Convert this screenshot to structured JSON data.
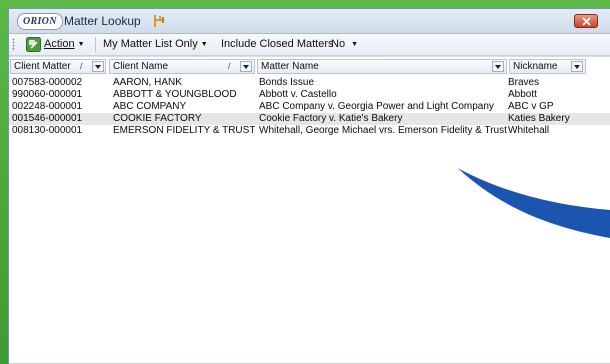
{
  "window": {
    "logo": "ORION",
    "title": "Matter Lookup"
  },
  "toolbar": {
    "action_label": "Action",
    "list_filter_label": "My Matter List Only",
    "include_closed_label": "Include Closed Matters",
    "include_closed_value": "No"
  },
  "grid": {
    "headers": {
      "client_matter": "Client Matter",
      "client_name": "Client Name",
      "matter_name": "Matter Name",
      "nickname": "Nickname"
    },
    "rows": [
      {
        "client_matter": "007583-000002",
        "client_name": "AARON, HANK",
        "matter_name": "Bonds Issue",
        "nickname": "Braves"
      },
      {
        "client_matter": "990060-000001",
        "client_name": "ABBOTT & YOUNGBLOOD",
        "matter_name": "Abbott v. Castello",
        "nickname": "Abbott"
      },
      {
        "client_matter": "002248-000001",
        "client_name": "ABC COMPANY",
        "matter_name": "ABC Company v. Georgia Power and Light Company",
        "nickname": "ABC v GP"
      },
      {
        "client_matter": "001546-000001",
        "client_name": "COOKIE FACTORY",
        "matter_name": "Cookie Factory v. Katie's Bakery",
        "nickname": "Katies Bakery"
      },
      {
        "client_matter": "008130-000001",
        "client_name": "EMERSON FIDELITY & TRUST",
        "matter_name": "Whitehall, George Michael vrs. Emerson Fidelity & Trust",
        "nickname": "Whitehall"
      }
    ]
  },
  "colors": {
    "background_green": "#4aa53a",
    "swoosh_blue": "#1b55b0",
    "selected_row": "#e6e6e6"
  },
  "icons": [
    "pin-icon",
    "close-icon",
    "action-icon",
    "chevron-down-icon",
    "sort-icon"
  ]
}
